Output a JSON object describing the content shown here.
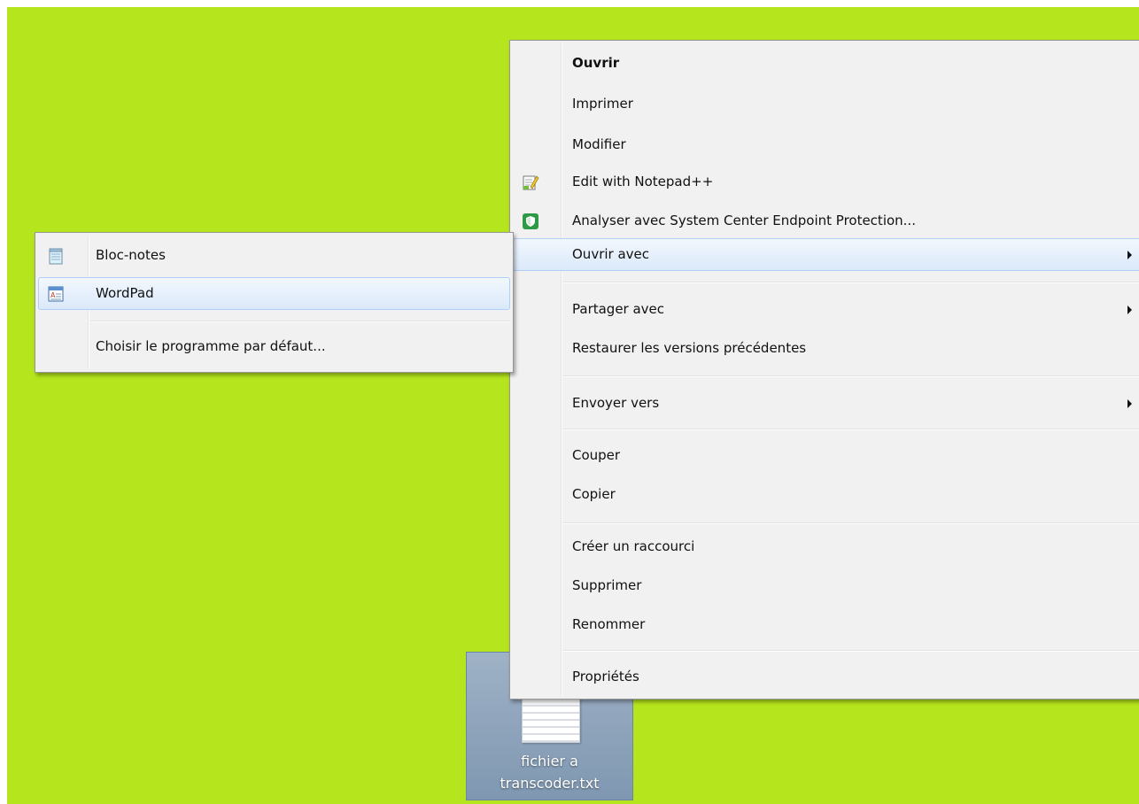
{
  "desktop": {
    "background_color": "#b5e61d",
    "file": {
      "name_line1": "fichier a",
      "name_line2": "transcoder.txt"
    }
  },
  "context_menu": {
    "items": [
      {
        "label": "Ouvrir",
        "bold": true
      },
      {
        "label": "Imprimer"
      },
      {
        "label": "Modifier"
      },
      {
        "label": "Edit with Notepad++",
        "icon": "notepadpp-icon"
      },
      {
        "label": "Analyser avec System Center Endpoint Protection...",
        "icon": "shield-icon"
      },
      {
        "label": "Ouvrir avec",
        "submenu": true,
        "highlighted": true
      },
      {
        "label": "Partager avec",
        "submenu": true
      },
      {
        "label": "Restaurer les versions précédentes"
      },
      {
        "label": "Envoyer vers",
        "submenu": true
      },
      {
        "label": "Couper"
      },
      {
        "label": "Copier"
      },
      {
        "label": "Créer un raccourci"
      },
      {
        "label": "Supprimer"
      },
      {
        "label": "Renommer"
      },
      {
        "label": "Propriétés"
      }
    ]
  },
  "open_with_submenu": {
    "items": [
      {
        "label": "Bloc-notes",
        "icon": "notepad-icon"
      },
      {
        "label": "WordPad",
        "icon": "wordpad-icon",
        "highlighted": true
      },
      {
        "label": "Choisir le programme par défaut..."
      }
    ]
  },
  "colors": {
    "highlight_border": "#aecff7",
    "menu_background": "#f1f1f1"
  }
}
